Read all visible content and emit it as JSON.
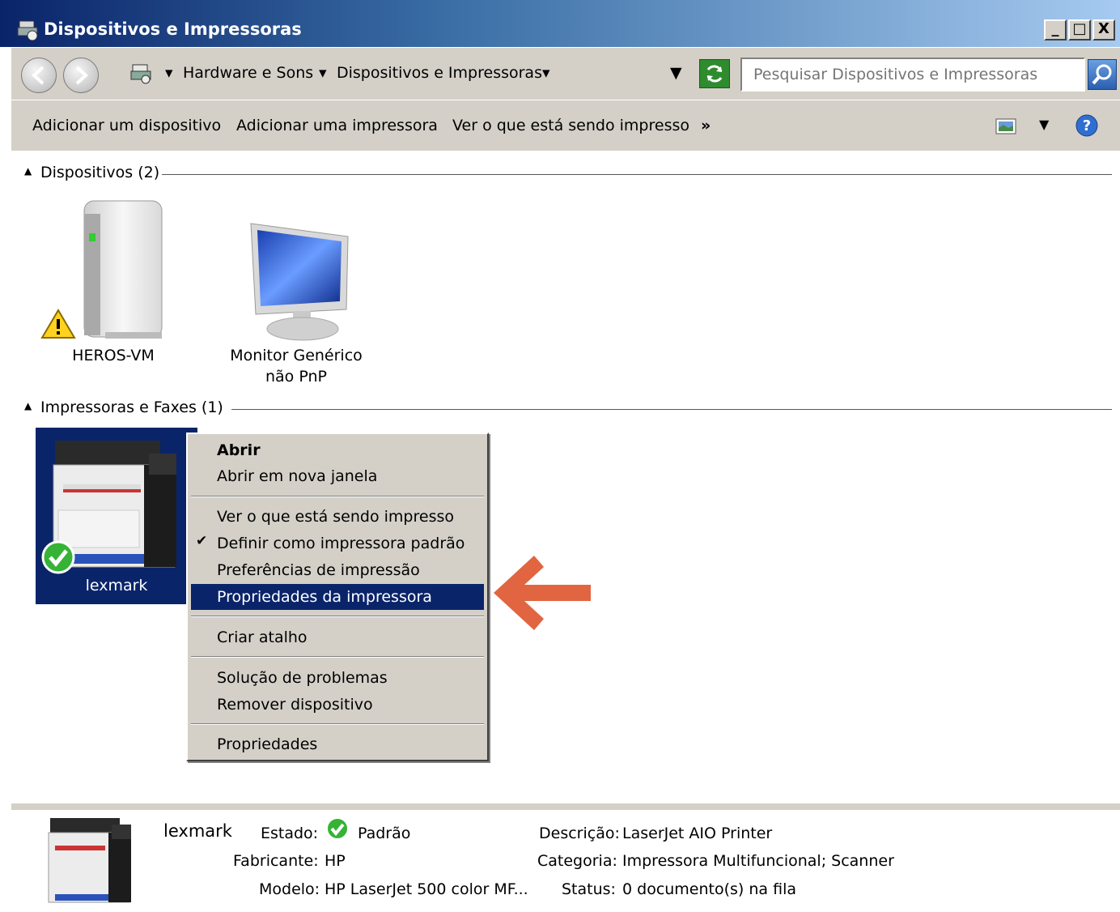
{
  "window": {
    "title": "Dispositivos e Impressoras"
  },
  "window_controls": {
    "minimize": "_",
    "maximize": "□",
    "close": "X"
  },
  "address": {
    "crumbs": [
      "Hardware e Sons",
      "Dispositivos e Impressoras"
    ]
  },
  "search": {
    "placeholder": "Pesquisar Dispositivos e Impressoras"
  },
  "toolbar": {
    "add_device": "Adicionar um dispositivo",
    "add_printer": "Adicionar uma impressora",
    "see_printing": "Ver o que está sendo impresso",
    "more": "»"
  },
  "groups": {
    "devices": {
      "header": "Dispositivos (2)",
      "items": [
        {
          "label": "HEROS-VM",
          "status_icon": "warning-icon"
        },
        {
          "label_line1": "Monitor Genérico",
          "label_line2": "não PnP"
        }
      ]
    },
    "printers": {
      "header": "Impressoras e Faxes (1)",
      "items": [
        {
          "label": "lexmark",
          "status_icon": "check-icon",
          "selected": true
        }
      ]
    }
  },
  "context_menu": {
    "items": [
      {
        "label": "Abrir",
        "bold": true
      },
      {
        "label": "Abrir em nova janela"
      },
      {
        "label": "Ver o que está sendo impresso"
      },
      {
        "label": "Definir como impressora padrão",
        "checked": true
      },
      {
        "label": "Preferências de impressão"
      },
      {
        "label": "Propriedades da impressora",
        "highlighted": true
      },
      {
        "label": "Criar atalho"
      },
      {
        "label": "Solução de problemas"
      },
      {
        "label": "Remover dispositivo"
      },
      {
        "label": "Propriedades"
      }
    ]
  },
  "annotation": {
    "arrow_color": "#e06540"
  },
  "details": {
    "name": "lexmark",
    "estado_label": "Estado:",
    "estado_value": "Padrão",
    "fabricante_label": "Fabricante:",
    "fabricante_value": "HP",
    "modelo_label": "Modelo:",
    "modelo_value": "HP LaserJet 500 color MF...",
    "descricao_label": "Descrição:",
    "descricao_value": "LaserJet AIO Printer",
    "categoria_label": "Categoria:",
    "categoria_value": "Impressora Multifuncional; Scanner",
    "status_label": "Status:",
    "status_value": "0 documento(s) na fila"
  },
  "colors": {
    "selection": "#0a246a",
    "face": "#d4d0c8",
    "title_start": "#0a246a",
    "title_end": "#a6caf0"
  }
}
